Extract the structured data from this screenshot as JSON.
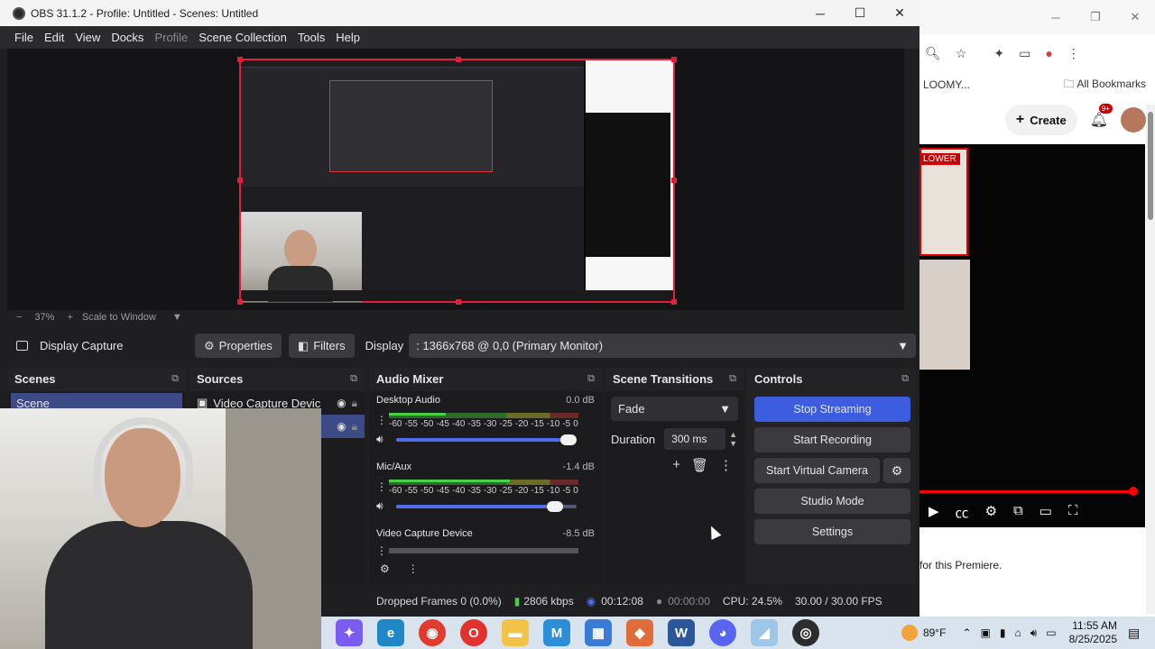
{
  "window": {
    "title": "OBS 31.1.2 - Profile: Untitled - Scenes: Untitled",
    "minimize": "─",
    "maximize": "☐",
    "close": "✕"
  },
  "menu": [
    "File",
    "Edit",
    "View",
    "Docks",
    "Profile",
    "Scene Collection",
    "Tools",
    "Help"
  ],
  "zoom": {
    "minus": "−",
    "level": "37%",
    "plus": "+",
    "mode": "Scale to Window"
  },
  "source_toolbar": {
    "source_name": "Display Capture",
    "properties": "Properties",
    "filters": "Filters",
    "display_label": "Display",
    "display_value": ": 1366x768 @ 0,0 (Primary Monitor)"
  },
  "docks": {
    "scenes": {
      "title": "Scenes",
      "items": [
        "Scene"
      ]
    },
    "sources": {
      "title": "Sources",
      "items": [
        "Video Capture Devic"
      ]
    },
    "audio_mixer": {
      "title": "Audio Mixer",
      "channels": [
        {
          "name": "Desktop Audio",
          "db": "0.0 dB",
          "level": 0.3,
          "volume": 1.0
        },
        {
          "name": "Mic/Aux",
          "db": "-1.4 dB",
          "level": 0.64,
          "volume": 0.92
        },
        {
          "name": "Video Capture Device",
          "db": "-8.5 dB",
          "level": 0.0,
          "volume": 0.0
        }
      ],
      "ticks": [
        "-60",
        "-55",
        "-50",
        "-45",
        "-40",
        "-35",
        "-30",
        "-25",
        "-20",
        "-15",
        "-10",
        "-5",
        "0"
      ]
    },
    "scene_transitions": {
      "title": "Scene Transitions",
      "transition": "Fade",
      "duration_label": "Duration",
      "duration_value": "300 ms"
    },
    "controls": {
      "title": "Controls",
      "stop_streaming": "Stop Streaming",
      "start_recording": "Start Recording",
      "start_virtual_camera": "Start Virtual Camera",
      "studio_mode": "Studio Mode",
      "settings": "Settings"
    }
  },
  "status": {
    "dropped_frames": "Dropped Frames 0 (0.0%)",
    "bitrate": "2806 kbps",
    "stream_time": "00:12:08",
    "rec_time": "00:00:00",
    "cpu": "CPU: 24.5%",
    "fps": "30.00 / 30.00 FPS"
  },
  "browser": {
    "bookmark_left": "LOOMY...",
    "all_bookmarks": "All Bookmarks",
    "create": "Create",
    "notif_badge": "9+",
    "lower_label": "LOWER",
    "premiere_text": "for this Premiere.",
    "progress": 0.95
  },
  "taskbar": {
    "temperature": "89°F",
    "time": "11:55 AM",
    "date": "8/25/2025",
    "apps": [
      "copilot",
      "edge",
      "chrome",
      "opera",
      "explorer",
      "m365",
      "store",
      "git",
      "word",
      "discord",
      "notes",
      "obs"
    ]
  }
}
